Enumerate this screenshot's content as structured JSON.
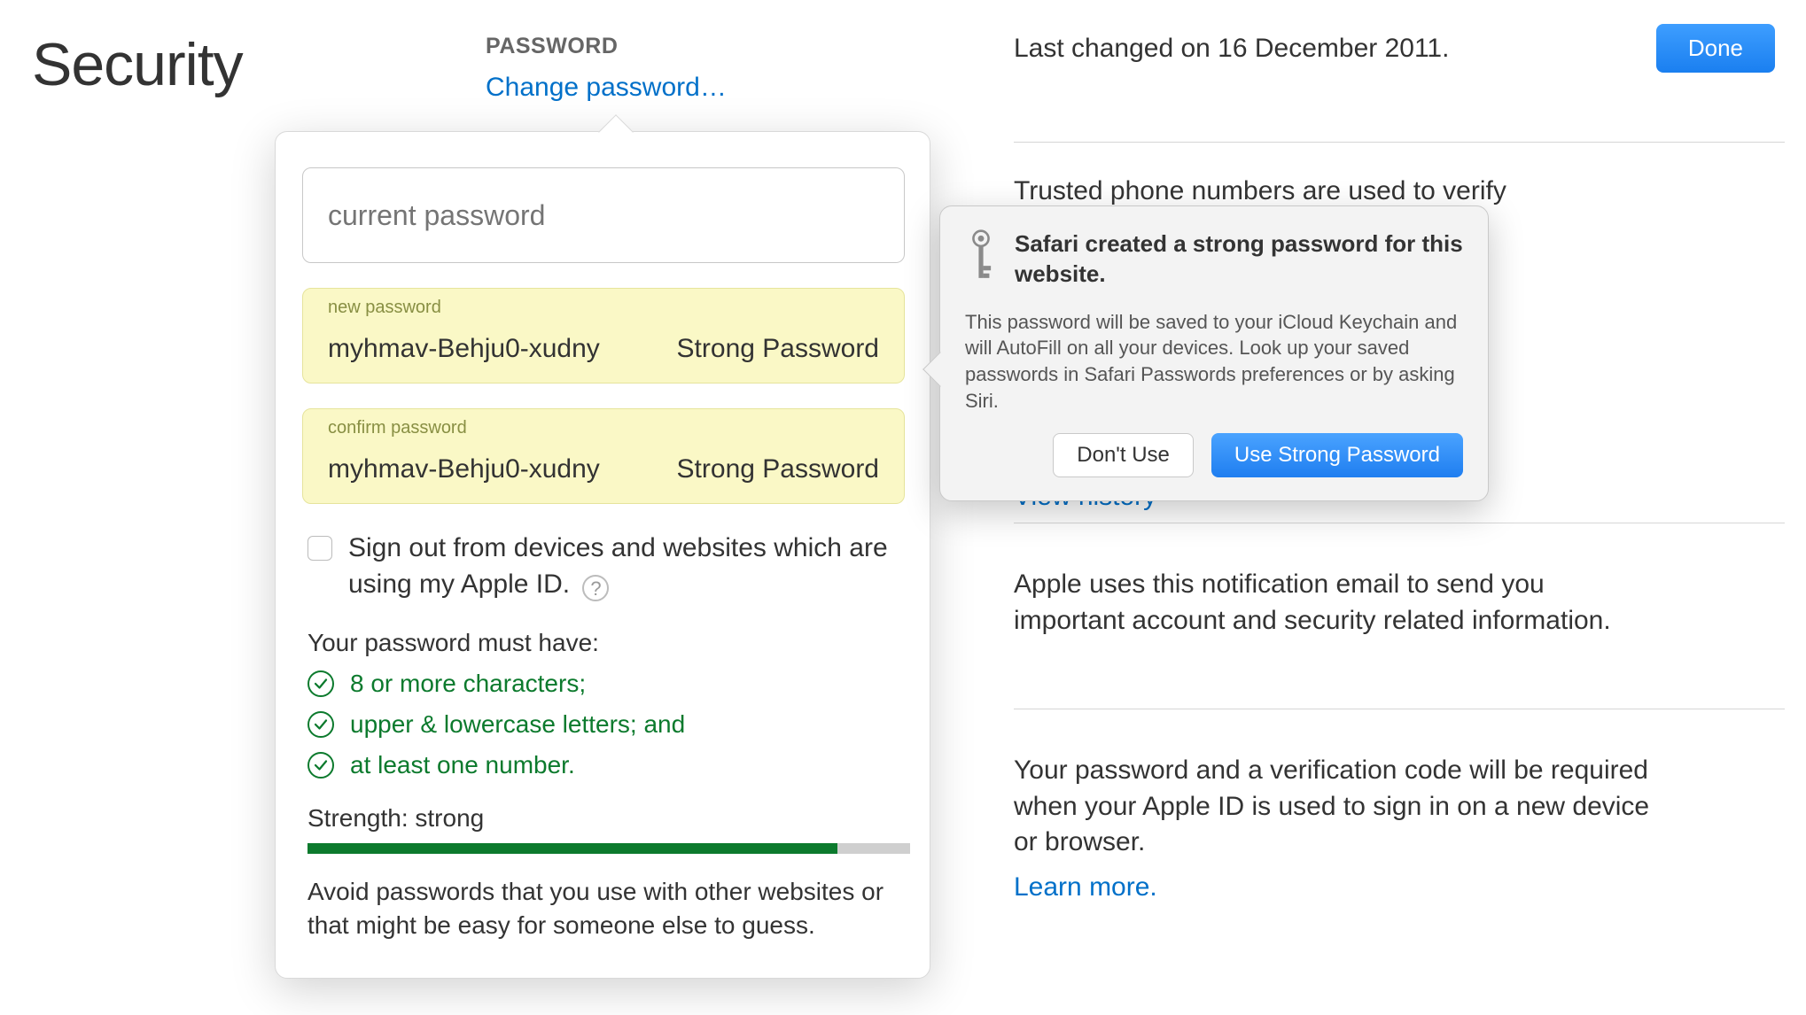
{
  "page": {
    "title": "Security"
  },
  "password_header": {
    "label": "PASSWORD",
    "change_link": "Change password…",
    "last_changed": "Last changed on 16 December 2011."
  },
  "done_button": "Done",
  "right": {
    "trusted_text": "Trusted phone numbers are used to verify",
    "view_history": "View history",
    "email_text": "Apple uses this notification email to send you important account and security related information.",
    "twofactor_text": "Your password and a verification code will be required when your Apple ID is used to sign in on a new device or browser.",
    "learn_more": "Learn more."
  },
  "popover": {
    "current_placeholder": "current password",
    "new_label": "new password",
    "confirm_label": "confirm password",
    "password_value": "myhmav-Behju0-xudny",
    "strong_label": "Strong Password",
    "signout_label": "Sign out from devices and websites which are using my Apple ID.",
    "req_title": "Your password must have:",
    "reqs": [
      "8 or more characters;",
      "upper & lowercase letters; and",
      "at least one number."
    ],
    "strength_label": "Strength: strong",
    "advice": "Avoid passwords that you use with other websites or that might be easy for someone else to guess."
  },
  "safari": {
    "title": "Safari created a strong password for this website.",
    "body": "This password will be saved to your iCloud Keychain and will AutoFill on all your devices. Look up your saved passwords in Safari Passwords preferences or by asking Siri.",
    "dont_use": "Don't Use",
    "use_strong": "Use Strong Password"
  }
}
